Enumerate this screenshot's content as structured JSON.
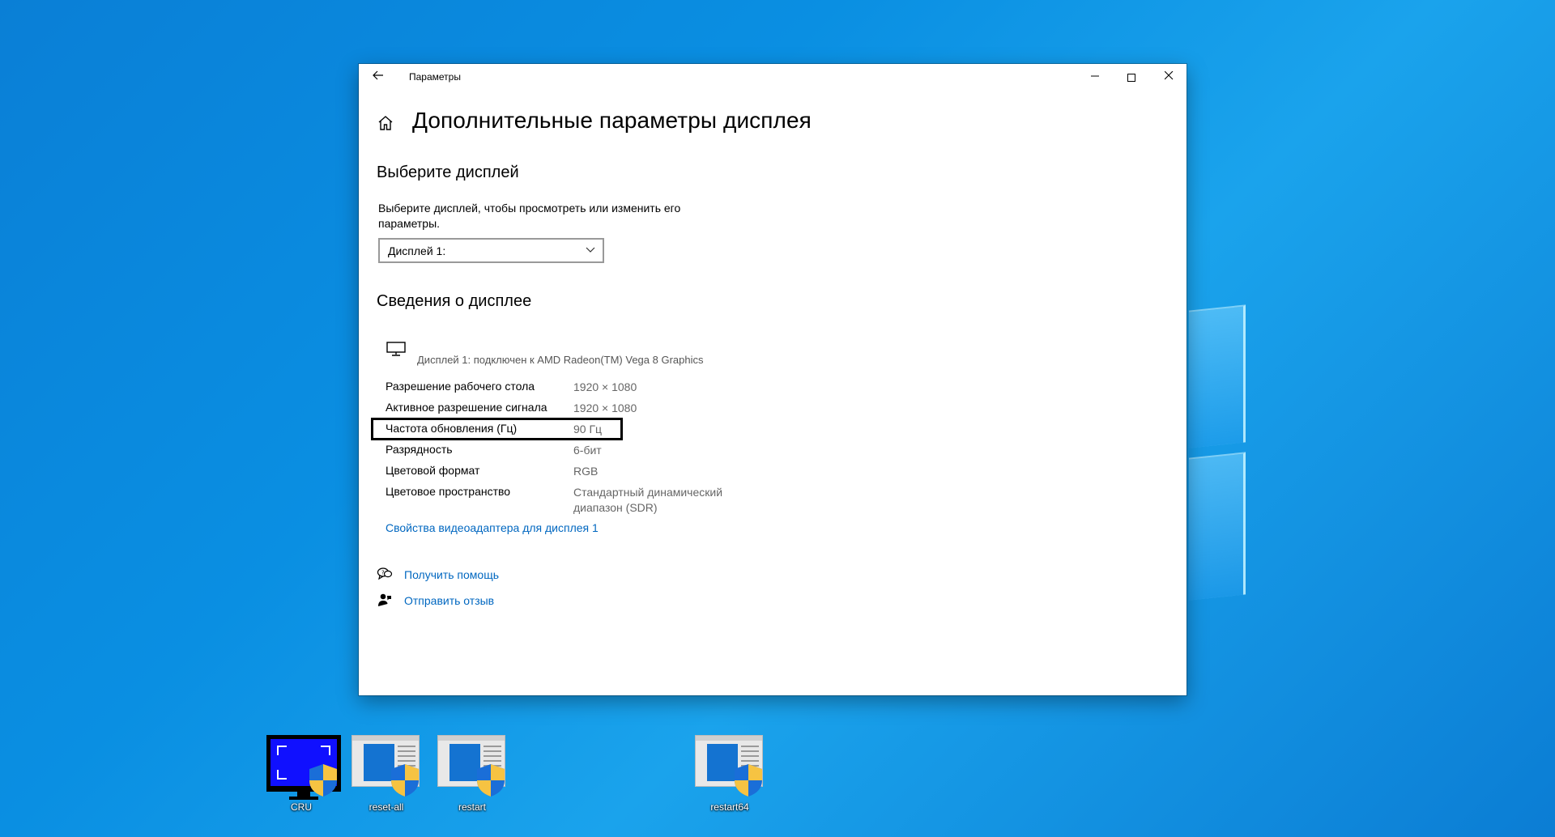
{
  "window": {
    "title": "Параметры",
    "back_icon": "arrow-left-icon",
    "minimize_glyph": "—",
    "close_glyph": "✕"
  },
  "page": {
    "title": "Дополнительные параметры дисплея",
    "select_heading": "Выберите дисплей",
    "select_description": "Выберите дисплей, чтобы просмотреть или изменить его параметры.",
    "dropdown_value": "Дисплей 1:",
    "info_heading": "Сведения о дисплее",
    "connection": "Дисплей 1: подключен к AMD Radeon(TM) Vega 8 Graphics",
    "rows": [
      {
        "label": "Разрешение рабочего стола",
        "value": "1920 × 1080"
      },
      {
        "label": "Активное разрешение сигнала",
        "value": "1920 × 1080"
      },
      {
        "label": "Частота обновления (Гц)",
        "value": "90 Гц"
      },
      {
        "label": "Разрядность",
        "value": "6-бит"
      },
      {
        "label": "Цветовой формат",
        "value": "RGB"
      },
      {
        "label": "Цветовое пространство",
        "value": "Стандартный динамический диапазон (SDR)"
      }
    ],
    "adapter_link": "Свойства видеоадаптера для дисплея 1",
    "help_link": "Получить помощь",
    "feedback_link": "Отправить отзыв"
  },
  "desktop": {
    "icons": [
      {
        "label": "CRU"
      },
      {
        "label": "reset-all"
      },
      {
        "label": "restart"
      },
      {
        "label": "restart64"
      }
    ]
  },
  "colors": {
    "link": "#0067c0",
    "desktop_bg": "#0a8fe2",
    "highlight_border": "#000000"
  }
}
